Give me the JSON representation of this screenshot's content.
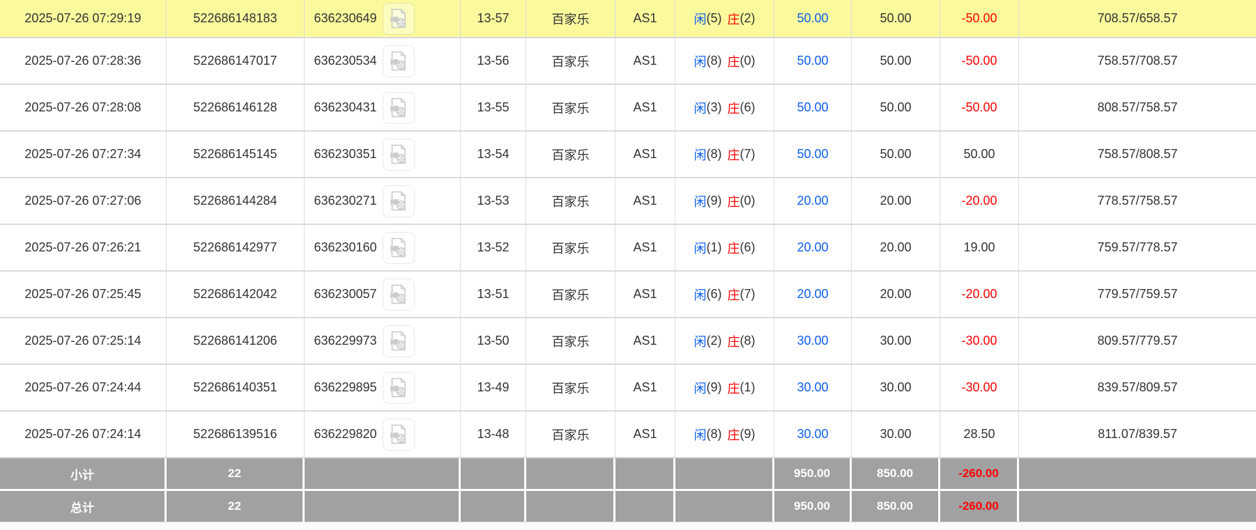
{
  "colors": {
    "highlight_row_bg": "#fafa9d",
    "link_blue": "#0d5eed",
    "loss_red": "#ff0000",
    "summary_bg": "#a1a1a1",
    "border": "#d9d9d9",
    "text": "#333333"
  },
  "icons": {
    "video_replay": "video-file-icon"
  },
  "rows": [
    {
      "time": "2025-07-26 07:29:19",
      "bet_id": "522686148183",
      "game_id": "636230649",
      "round": "13-57",
      "game": "百家乐",
      "table": "AS1",
      "result_player_label": "闲",
      "result_player": "(5)",
      "result_banker_label": "庄",
      "result_banker": "(2)",
      "bet": "50.00",
      "valid": "50.00",
      "win_loss": "-50.00",
      "balance": "708.57/658.57",
      "highlighted": true
    },
    {
      "time": "2025-07-26 07:28:36",
      "bet_id": "522686147017",
      "game_id": "636230534",
      "round": "13-56",
      "game": "百家乐",
      "table": "AS1",
      "result_player_label": "闲",
      "result_player": "(8)",
      "result_banker_label": "庄",
      "result_banker": "(0)",
      "bet": "50.00",
      "valid": "50.00",
      "win_loss": "-50.00",
      "balance": "758.57/708.57",
      "highlighted": false
    },
    {
      "time": "2025-07-26 07:28:08",
      "bet_id": "522686146128",
      "game_id": "636230431",
      "round": "13-55",
      "game": "百家乐",
      "table": "AS1",
      "result_player_label": "闲",
      "result_player": "(3)",
      "result_banker_label": "庄",
      "result_banker": "(6)",
      "bet": "50.00",
      "valid": "50.00",
      "win_loss": "-50.00",
      "balance": "808.57/758.57",
      "highlighted": false
    },
    {
      "time": "2025-07-26 07:27:34",
      "bet_id": "522686145145",
      "game_id": "636230351",
      "round": "13-54",
      "game": "百家乐",
      "table": "AS1",
      "result_player_label": "闲",
      "result_player": "(8)",
      "result_banker_label": "庄",
      "result_banker": "(7)",
      "bet": "50.00",
      "valid": "50.00",
      "win_loss": "50.00",
      "balance": "758.57/808.57",
      "highlighted": false
    },
    {
      "time": "2025-07-26 07:27:06",
      "bet_id": "522686144284",
      "game_id": "636230271",
      "round": "13-53",
      "game": "百家乐",
      "table": "AS1",
      "result_player_label": "闲",
      "result_player": "(9)",
      "result_banker_label": "庄",
      "result_banker": "(0)",
      "bet": "20.00",
      "valid": "20.00",
      "win_loss": "-20.00",
      "balance": "778.57/758.57",
      "highlighted": false
    },
    {
      "time": "2025-07-26 07:26:21",
      "bet_id": "522686142977",
      "game_id": "636230160",
      "round": "13-52",
      "game": "百家乐",
      "table": "AS1",
      "result_player_label": "闲",
      "result_player": "(1)",
      "result_banker_label": "庄",
      "result_banker": "(6)",
      "bet": "20.00",
      "valid": "20.00",
      "win_loss": "19.00",
      "balance": "759.57/778.57",
      "highlighted": false
    },
    {
      "time": "2025-07-26 07:25:45",
      "bet_id": "522686142042",
      "game_id": "636230057",
      "round": "13-51",
      "game": "百家乐",
      "table": "AS1",
      "result_player_label": "闲",
      "result_player": "(6)",
      "result_banker_label": "庄",
      "result_banker": "(7)",
      "bet": "20.00",
      "valid": "20.00",
      "win_loss": "-20.00",
      "balance": "779.57/759.57",
      "highlighted": false
    },
    {
      "time": "2025-07-26 07:25:14",
      "bet_id": "522686141206",
      "game_id": "636229973",
      "round": "13-50",
      "game": "百家乐",
      "table": "AS1",
      "result_player_label": "闲",
      "result_player": "(2)",
      "result_banker_label": "庄",
      "result_banker": "(8)",
      "bet": "30.00",
      "valid": "30.00",
      "win_loss": "-30.00",
      "balance": "809.57/779.57",
      "highlighted": false
    },
    {
      "time": "2025-07-26 07:24:44",
      "bet_id": "522686140351",
      "game_id": "636229895",
      "round": "13-49",
      "game": "百家乐",
      "table": "AS1",
      "result_player_label": "闲",
      "result_player": "(9)",
      "result_banker_label": "庄",
      "result_banker": "(1)",
      "bet": "30.00",
      "valid": "30.00",
      "win_loss": "-30.00",
      "balance": "839.57/809.57",
      "highlighted": false
    },
    {
      "time": "2025-07-26 07:24:14",
      "bet_id": "522686139516",
      "game_id": "636229820",
      "round": "13-48",
      "game": "百家乐",
      "table": "AS1",
      "result_player_label": "闲",
      "result_player": "(8)",
      "result_banker_label": "庄",
      "result_banker": "(9)",
      "bet": "30.00",
      "valid": "30.00",
      "win_loss": "28.50",
      "balance": "811.07/839.57",
      "highlighted": false
    }
  ],
  "summary": {
    "subtotal": {
      "label": "小计",
      "count": "22",
      "bet_total": "950.00",
      "valid_total": "850.00",
      "win_loss_total": "-260.00"
    },
    "total": {
      "label": "总计",
      "count": "22",
      "bet_total": "950.00",
      "valid_total": "850.00",
      "win_loss_total": "-260.00"
    }
  }
}
